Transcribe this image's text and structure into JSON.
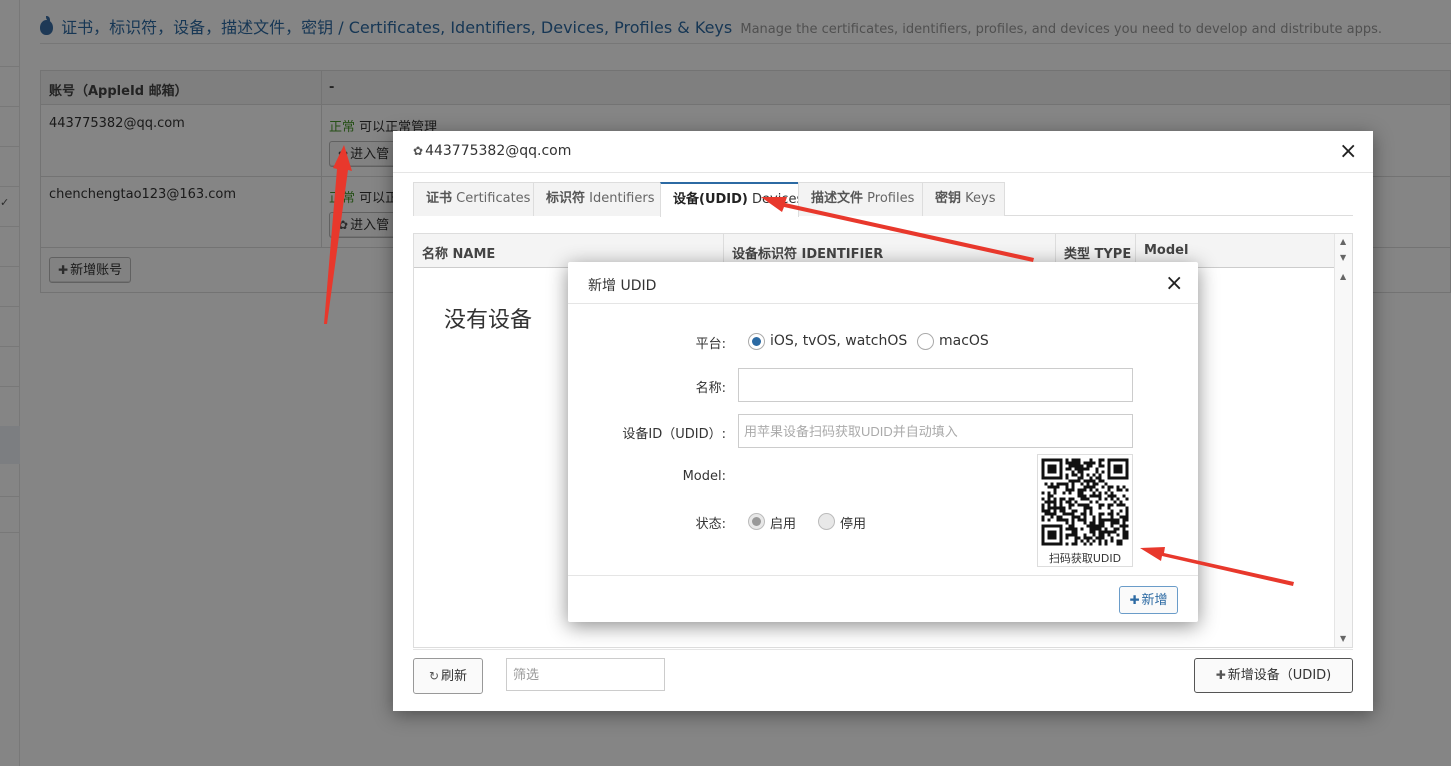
{
  "page": {
    "title": "证书，标识符，设备，描述文件，密钥 / Certificates, Identifiers, Devices, Profiles & Keys",
    "subtitle": "Manage the certificates, identifiers, profiles, and devices you need to develop and distribute apps.",
    "left_check": "✓"
  },
  "accounts_table": {
    "col_account": "账号（AppleId 邮箱）",
    "col_status": "-",
    "rows": [
      {
        "email": "443775382@qq.com",
        "status_ok": "正常",
        "status_text": "可以正常管理",
        "manage_label": "进入管"
      },
      {
        "email": "chenchengtao123@163.com",
        "status_ok": "正常",
        "status_text": "可以正",
        "manage_label": "进入管"
      }
    ],
    "add_account_label": "新增账号"
  },
  "account_dialog": {
    "title": "443775382@qq.com",
    "close": "×",
    "tabs": [
      {
        "bold": "证书",
        "label": " Certificates"
      },
      {
        "bold": "标识符",
        "label": " Identifiers"
      },
      {
        "bold": "设备(UDID)",
        "label": " Devices"
      },
      {
        "bold": "描述文件",
        "label": " Profiles"
      },
      {
        "bold": "密钥",
        "label": " Keys"
      }
    ],
    "active_tab": "设备(UDID) Devices",
    "columns": [
      "名称 NAME",
      "设备标识符 IDENTIFIER",
      "类型 TYPE",
      "Model"
    ],
    "empty_message": "没有设备",
    "refresh_label": "刷新",
    "filter_placeholder": "筛选",
    "add_device_label": "新增设备（UDID)"
  },
  "udid_dialog": {
    "title": "新增 UDID",
    "close": "×",
    "platform_label": "平台:",
    "platform_options": [
      "iOS, tvOS, watchOS",
      "macOS"
    ],
    "platform_selected": "iOS, tvOS, watchOS",
    "name_label": "名称:",
    "name_value": "",
    "udid_label": "设备ID（UDID）:",
    "udid_value": "",
    "udid_placeholder": "用苹果设备扫码获取UDID并自动填入",
    "model_label": "Model:",
    "status_label": "状态:",
    "status_options": [
      "启用",
      "停用"
    ],
    "status_selected": "启用",
    "qr_caption": "扫码获取UDID",
    "add_label": "新增"
  },
  "colors": {
    "brand": "#2c6aa3",
    "ok": "#4a9a2c",
    "annotation": "#e8382c"
  }
}
